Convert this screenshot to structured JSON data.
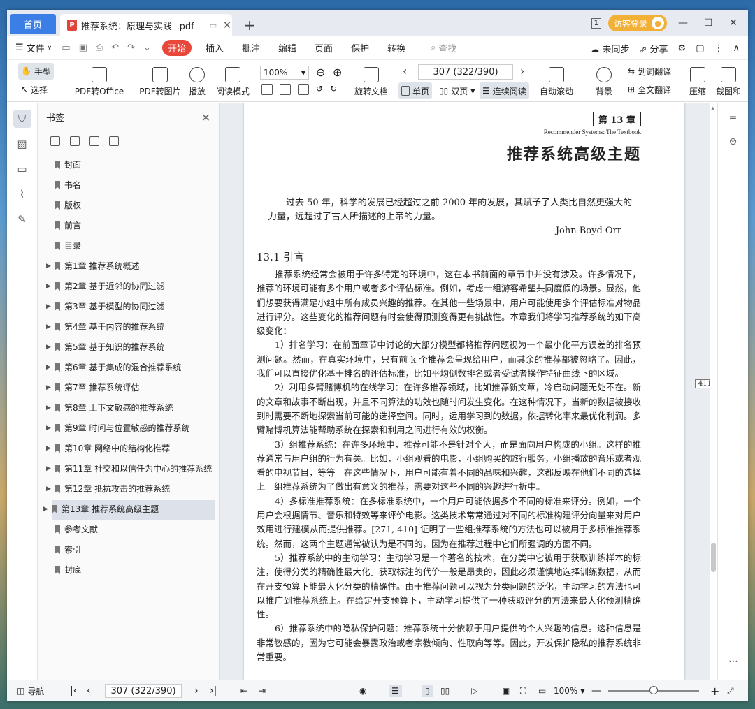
{
  "tabs": {
    "home": "首页",
    "doc_title": "推荐系统：原理与实践_.pdf",
    "new_tab": "+"
  },
  "account": {
    "badge": "1",
    "login": "访客登录"
  },
  "menu": {
    "file": "文件",
    "items": [
      "开始",
      "插入",
      "批注",
      "编辑",
      "页面",
      "保护",
      "转换"
    ],
    "search": "查找",
    "sync": "未同步",
    "share": "分享"
  },
  "toolbar": {
    "hand": "手型",
    "select": "选择",
    "to_office": "PDF转Office",
    "to_image": "PDF转图片",
    "play": "播放",
    "read_mode": "阅读模式",
    "zoom": "100%",
    "rotate": "旋转文档",
    "page_display": "307 (322/390)",
    "single": "单页",
    "double": "双页",
    "continuous": "连续阅读",
    "auto_scroll": "自动滚动",
    "background": "背景",
    "word_translate": "划词翻译",
    "full_translate": "全文翻译",
    "compress": "压缩",
    "screenshot": "截图和"
  },
  "sidebar": {
    "title": "书签",
    "bookmarks": [
      {
        "label": "封面",
        "expandable": false
      },
      {
        "label": "书名",
        "expandable": false
      },
      {
        "label": "版权",
        "expandable": false
      },
      {
        "label": "前言",
        "expandable": false
      },
      {
        "label": "目录",
        "expandable": false
      },
      {
        "label": "第1章  推荐系统概述",
        "expandable": true
      },
      {
        "label": "第2章  基于近邻的协同过滤",
        "expandable": true
      },
      {
        "label": "第3章  基于模型的协同过滤",
        "expandable": true
      },
      {
        "label": "第4章  基于内容的推荐系统",
        "expandable": true
      },
      {
        "label": "第5章  基于知识的推荐系统",
        "expandable": true
      },
      {
        "label": "第6章  基于集成的混合推荐系统",
        "expandable": true
      },
      {
        "label": "第7章  推荐系统评估",
        "expandable": true
      },
      {
        "label": "第8章  上下文敏感的推荐系统",
        "expandable": true
      },
      {
        "label": "第9章  时间与位置敏感的推荐系统",
        "expandable": true
      },
      {
        "label": "第10章  网络中的结构化推荐",
        "expandable": true
      },
      {
        "label": "第11章  社交和以信任为中心的推荐系统",
        "expandable": true
      },
      {
        "label": "第12章  抵抗攻击的推荐系统",
        "expandable": true
      },
      {
        "label": "第13章  推荐系统高级主题",
        "expandable": true,
        "selected": true
      },
      {
        "label": "参考文献",
        "expandable": false
      },
      {
        "label": "索引",
        "expandable": false
      },
      {
        "label": "封底",
        "expandable": false
      }
    ]
  },
  "document": {
    "chapter_no": "第 13 章",
    "chapter_en": "Recommender Systems: The Textbook",
    "chapter_title": "推荐系统高级主题",
    "epigraph": "过去 50 年，科学的发展已经超过之前 2000 年的发展，其赋予了人类比自然更强大的力量，远超过了古人所描述的上帝的力量。",
    "epigraph_source": "——John Boyd Orr",
    "section": "13.1   引言",
    "page_number": "411",
    "paragraphs": [
      "推荐系统经常会被用于许多特定的环境中，这在本书前面的章节中并没有涉及。许多情况下，推荐的环境可能有多个用户或者多个评估标准。例如，考虑一组游客希望共同度假的场景。显然，他们想要获得满足小组中所有成员兴趣的推荐。在其他一些场景中，用户可能使用多个评估标准对物品进行评分。这些变化的推荐问题有时会使得预测变得更有挑战性。本章我们将学习推荐系统的如下高级变化：",
      "1）排名学习：在前面章节中讨论的大部分模型都将推荐问题视为一个最小化平方误差的排名预测问题。然而，在真实环境中，只有前 k 个推荐会呈现给用户，而其余的推荐都被忽略了。因此，我们可以直接优化基于排名的评估标准，比如平均倒数排名或者受试者操作特征曲线下的区域。",
      "2）利用多臂赌博机的在线学习：在许多推荐领域，比如推荐新文章，冷启动问题无处不在。新的文章和故事不断出现，并且不同算法的功效也随时间发生变化。在这种情况下，当新的数据被接收到时需要不断地探索当前可能的选择空间。同时，运用学习到的数据，依据转化率来最优化利润。多臂赌博机算法能帮助系统在探索和利用之间进行有效的权衡。",
      "3）组推荐系统：在许多环境中，推荐可能不是针对个人，而是面向用户构成的小组。这样的推荐通常与用户组的行为有关。比如，小组观看的电影，小组购买的旅行服务，小组播放的音乐或者观看的电视节目，等等。在这些情况下，用户可能有着不同的品味和兴趣，这都反映在他们不同的选择上。组推荐系统为了做出有意义的推荐，需要对这些不同的兴趣进行折中。",
      "4）多标准推荐系统：在多标准系统中，一个用户可能依据多个不同的标准来评分。例如，一个用户会根据情节、音乐和特效等来评价电影。这类技术常常通过对不同的标准构建评分向量来对用户效用进行建模从而提供推荐。[271, 410] 证明了一些组推荐系统的方法也可以被用于多标准推荐系统。然而，这两个主题通常被认为是不同的，因为在推荐过程中它们所强调的方面不同。",
      "5）推荐系统中的主动学习：主动学习是一个著名的技术，在分类中它被用于获取训练样本的标注，使得分类的精确性最大化。获取标注的代价一般是昂贵的，因此必须谨慎地选择训练数据，从而在开支预算下能最大化分类的精确性。由于推荐问题可以视为分类问题的泛化，主动学习的方法也可以推广到推荐系统上。在给定开支预算下，主动学习提供了一种获取评分的方法来最大化预测精确性。",
      "6）推荐系统中的隐私保护问题：推荐系统十分依赖于用户提供的个人兴趣的信息。这种信息是非常敏感的，因为它可能会暴露政治或者宗教倾向、性取向等等。因此，开发保护隐私的推荐系统非常重要。"
    ]
  },
  "statusbar": {
    "nav": "导航",
    "page": "307 (322/390)",
    "zoom": "100%",
    "zoom_fraction": 0.5
  }
}
